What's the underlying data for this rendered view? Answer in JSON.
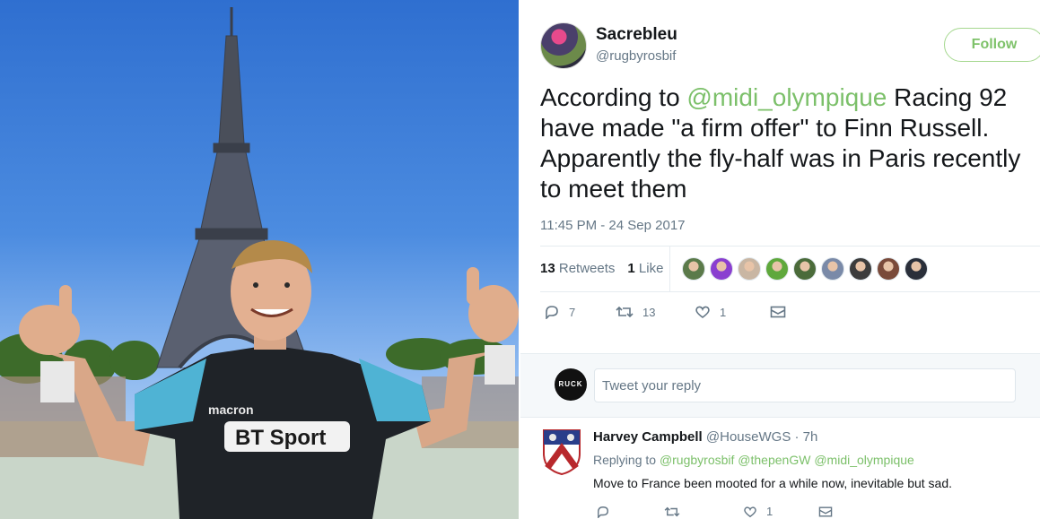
{
  "photo": {
    "alt": ""
  },
  "tweet": {
    "author": {
      "name": "Sacrebleu",
      "handle": "@rugbyrosbif"
    },
    "follow_label": "Follow",
    "text_lines": [
      [
        {
          "t": "According to ",
          "m": false
        },
        {
          "t": "@midi_olympique",
          "m": true
        },
        {
          "t": " Racing 92",
          "m": false
        }
      ],
      [
        {
          "t": "have made \"a firm offer\" to Finn Russell.",
          "m": false
        }
      ],
      [
        {
          "t": "Apparently the fly-half was in Paris recently",
          "m": false
        }
      ],
      [
        {
          "t": "to meet them",
          "m": false
        }
      ]
    ],
    "timestamp": "11:45 PM - 24 Sep 2017",
    "retweets_count": "13",
    "retweets_label": "Retweets",
    "likes_count": "1",
    "likes_label": "Like",
    "liker_colors": [
      "#5b7a4a",
      "#8a3fd0",
      "#c9b6a3",
      "#5fa83c",
      "#4b6b3a",
      "#7a8aa8",
      "#3c3c3c",
      "#7a4a3a",
      "#2a2f3a"
    ],
    "actions": {
      "reply_count": "7",
      "retweet_count": "13",
      "like_count": "1"
    }
  },
  "reply_box": {
    "avatar_text": "RUCK",
    "placeholder": "Tweet your reply"
  },
  "reply": {
    "name": "Harvey Campbell",
    "handle": "@HouseWGS",
    "time": "· 7h",
    "replying_prefix": "Replying to",
    "replying_to": [
      "@rugbyrosbif",
      "@thepenGW",
      "@midi_olympique"
    ],
    "text": "Move to France been mooted for a while now, inevitable but sad.",
    "actions": {
      "reply_count": "",
      "retweet_count": "",
      "like_count": "1"
    }
  },
  "colors": {
    "mention": "#7cc06a",
    "follow_border": "#a5d88f",
    "muted": "#657786"
  }
}
